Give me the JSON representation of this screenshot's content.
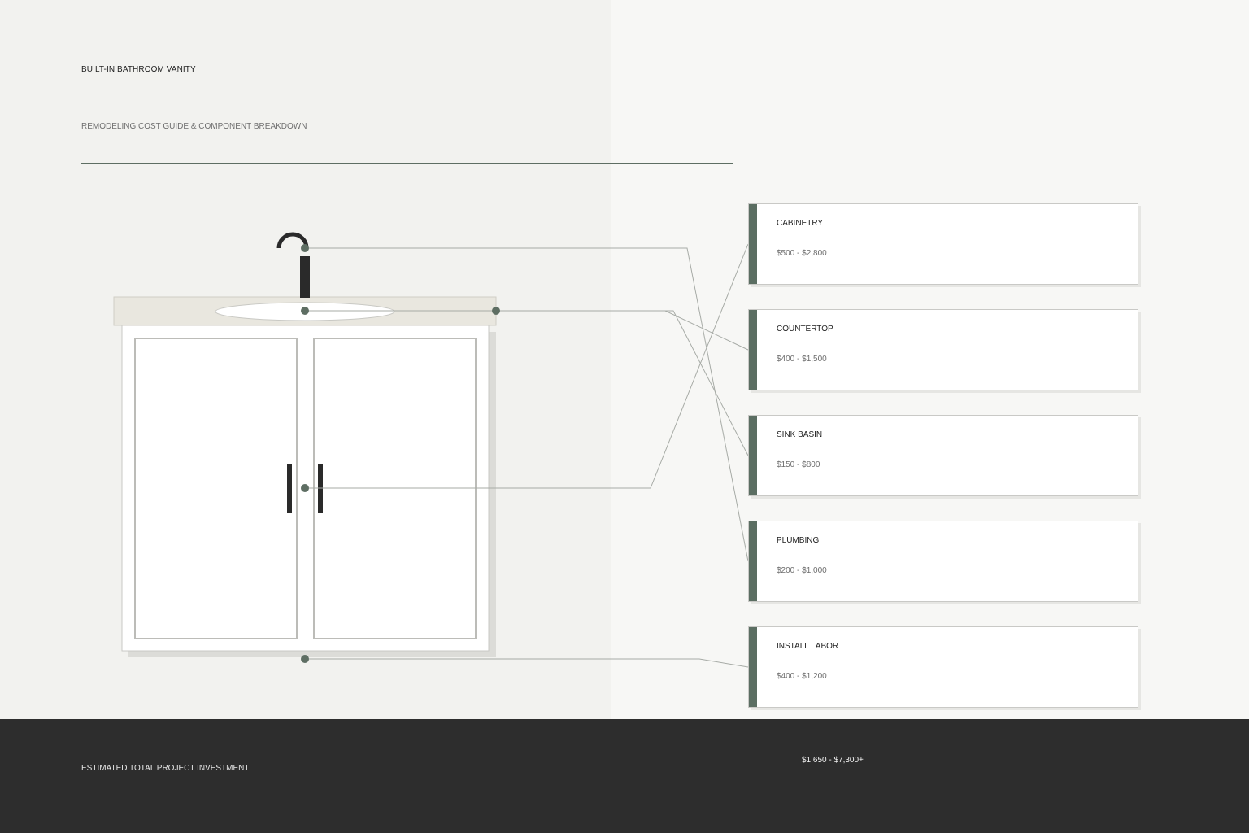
{
  "header": {
    "title": "BUILT-IN BATHROOM VANITY",
    "subtitle": "REMODELING COST GUIDE & COMPONENT BREAKDOWN"
  },
  "components": [
    {
      "name": "CABINETRY",
      "price": "$500 - $2,800"
    },
    {
      "name": "COUNTERTOP",
      "price": "$400 - $1,500"
    },
    {
      "name": "SINK BASIN",
      "price": "$150 - $800"
    },
    {
      "name": "PLUMBING",
      "price": "$200 - $1,000"
    },
    {
      "name": "INSTALL LABOR",
      "price": "$400 - $1,200"
    }
  ],
  "footer": {
    "label": "ESTIMATED TOTAL PROJECT INVESTMENT",
    "total": "$1,650 - $7,300+"
  },
  "colors": {
    "accent": "#5b6e62",
    "footer_bg": "#2d2d2d",
    "fixture": "#2a2a2a"
  }
}
